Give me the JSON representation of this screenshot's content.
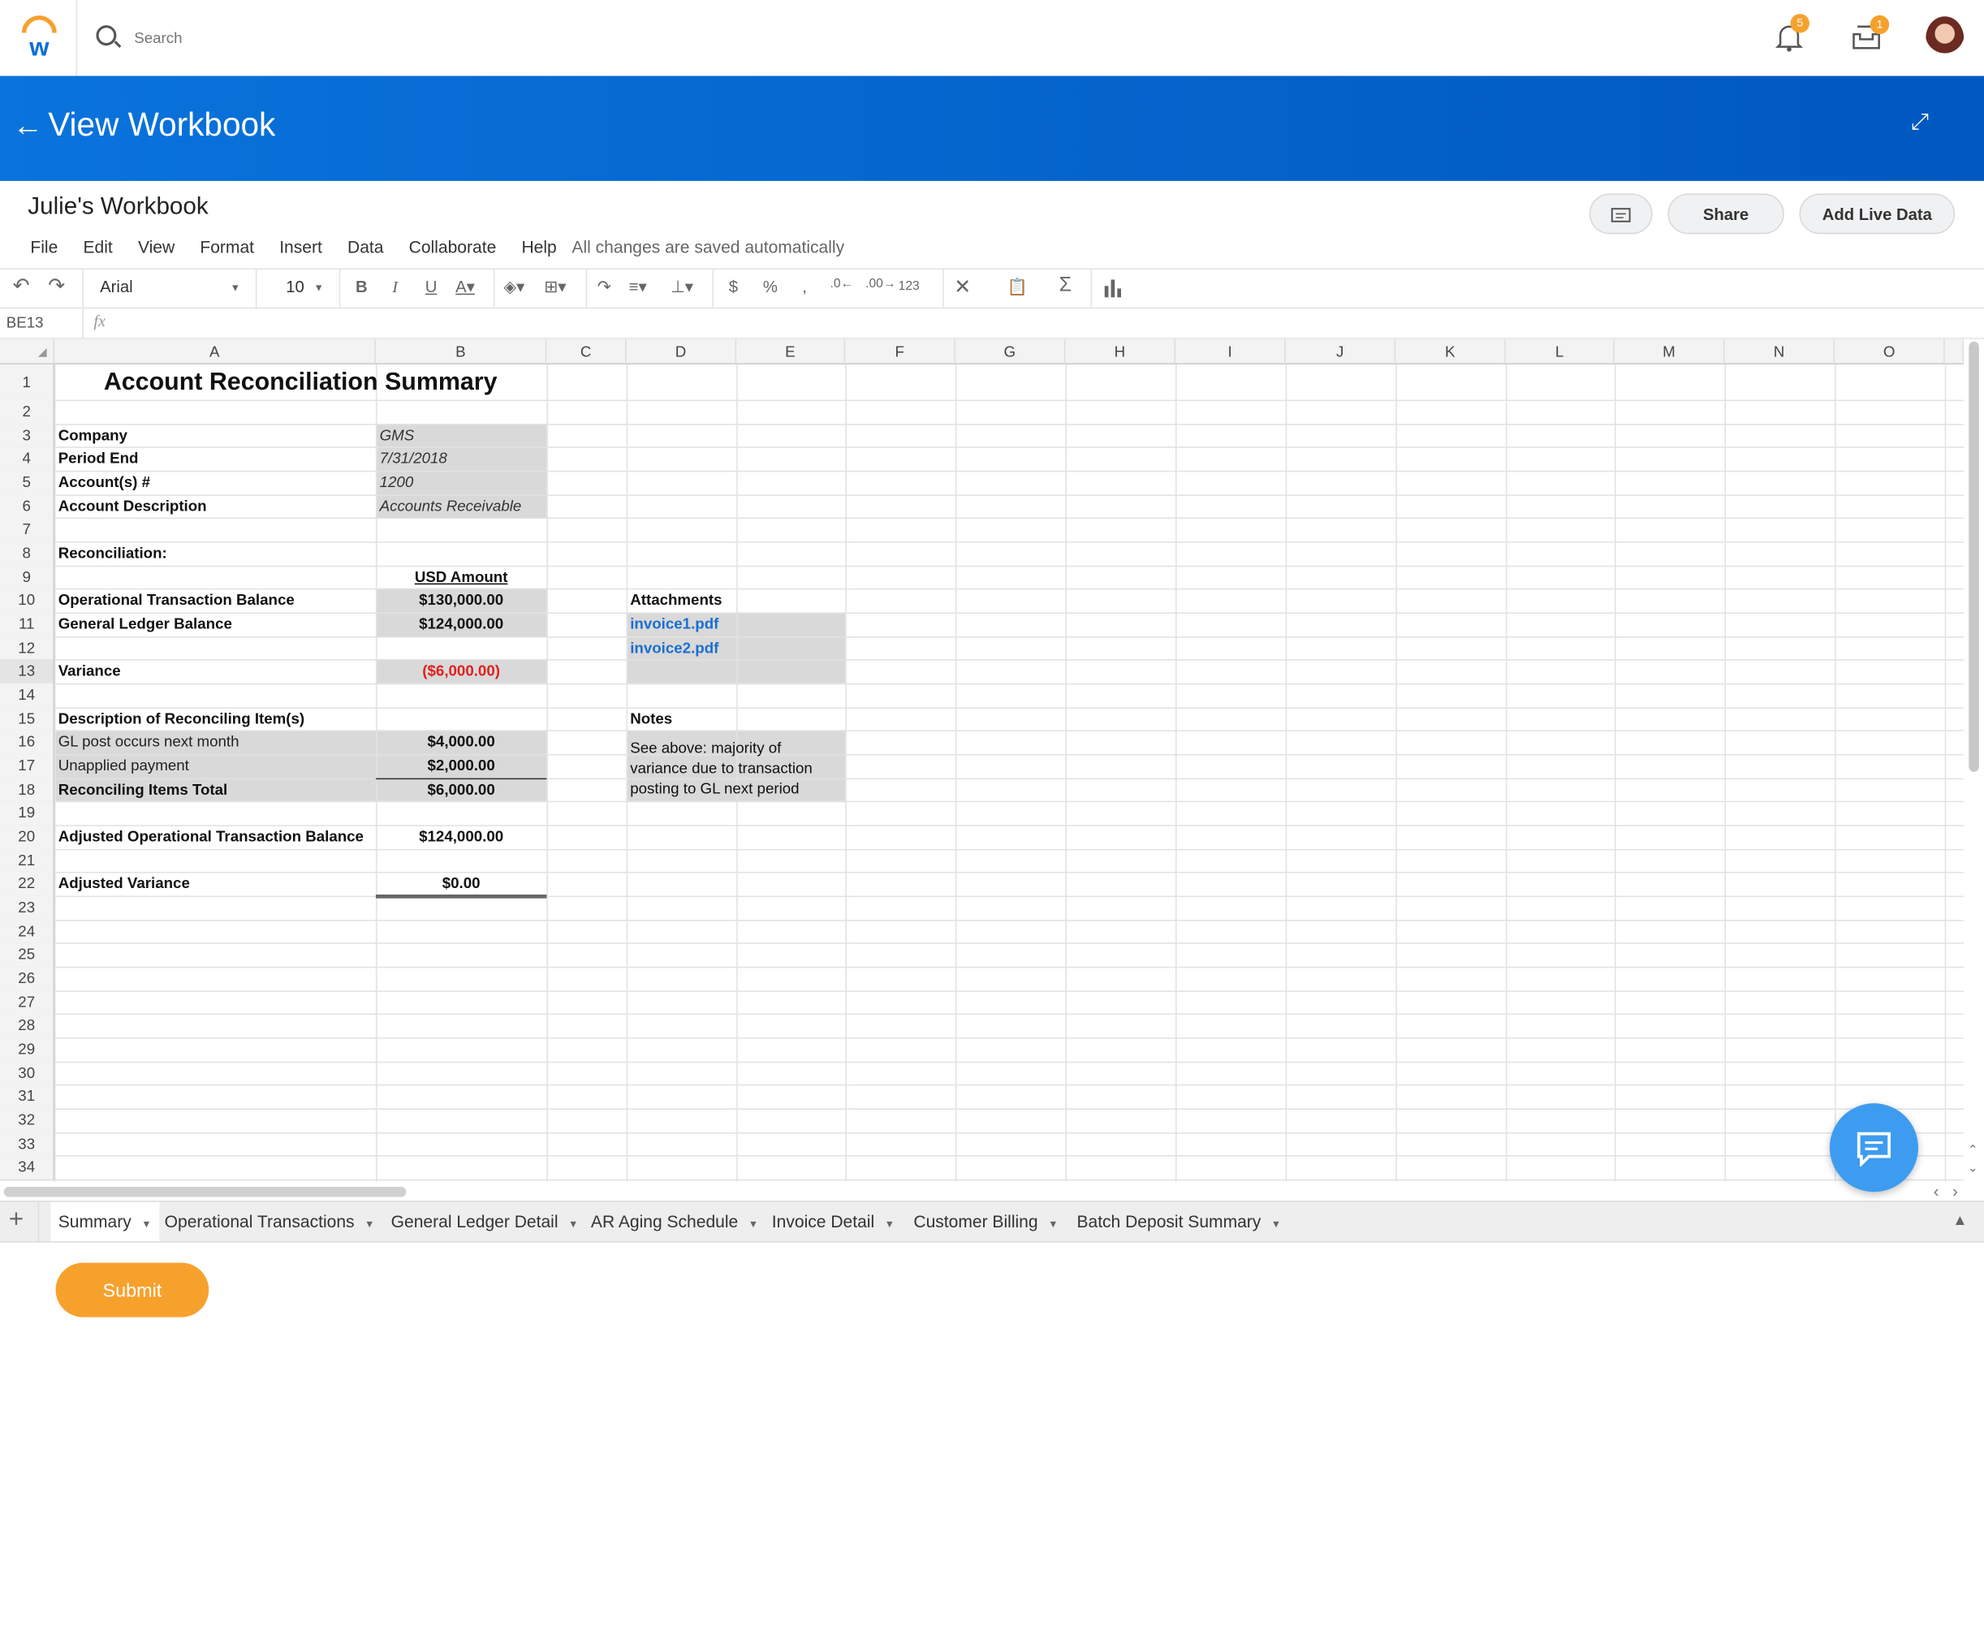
{
  "topbar": {
    "search_placeholder": "Search",
    "notifications_count": "5",
    "inbox_count": "1"
  },
  "header": {
    "title": "View Workbook"
  },
  "workbook": {
    "title": "Julie's Workbook",
    "share_label": "Share",
    "add_live_data_label": "Add Live Data",
    "menu": [
      "File",
      "Edit",
      "View",
      "Format",
      "Insert",
      "Data",
      "Collaborate",
      "Help"
    ],
    "save_status": "All changes are saved automatically"
  },
  "toolbar": {
    "font": "Arial",
    "font_size": "10",
    "number_format": "123"
  },
  "formula_bar": {
    "cell_ref": "BE13",
    "fx": "fx",
    "value": ""
  },
  "sheet": {
    "columns": [
      "A",
      "B",
      "C",
      "D",
      "E",
      "F",
      "G",
      "H",
      "I",
      "J",
      "K",
      "L",
      "M",
      "N",
      "O"
    ],
    "row_count": 34,
    "selected_row": 13,
    "cells": {
      "A1": "Account Reconciliation Summary",
      "A3": "Company",
      "B3": "GMS",
      "A4": "Period End",
      "B4": "7/31/2018",
      "A5": "Account(s) #",
      "B5": "1200",
      "A6": "Account Description",
      "B6": "Accounts Receivable",
      "A8": "Reconciliation:",
      "B9": "USD Amount",
      "A10": "Operational Transaction Balance",
      "B10": "$130,000.00",
      "D10": "Attachments",
      "A11": "General Ledger Balance",
      "B11": "$124,000.00",
      "D11": "invoice1.pdf",
      "D12": "invoice2.pdf",
      "A13": "Variance",
      "B13": "($6,000.00)",
      "A15": "Description of Reconciling Item(s)",
      "D15": "Notes",
      "A16": "GL post occurs next month",
      "B16": "$4,000.00",
      "D16": "See above: majority of variance due to transaction posting to GL next period",
      "A17": "Unapplied payment",
      "B17": "$2,000.00",
      "A18": "Reconciling Items Total",
      "B18": "$6,000.00",
      "A20": "Adjusted Operational Transaction Balance",
      "B20": "$124,000.00",
      "A22": "Adjusted Variance",
      "B22": "$0.00"
    },
    "colors": {
      "fill": "#d9d9d9",
      "negative": "#e02020",
      "link": "#1a6ecf"
    }
  },
  "sheet_tabs": [
    {
      "label": "Summary",
      "active": true
    },
    {
      "label": "Operational Transactions"
    },
    {
      "label": "General Ledger Detail"
    },
    {
      "label": "AR Aging Schedule"
    },
    {
      "label": "Invoice Detail"
    },
    {
      "label": "Customer Billing"
    },
    {
      "label": "Batch Deposit Summary"
    }
  ],
  "submit_label": "Submit",
  "colors": {
    "header_blue": "#0a73dc",
    "accent_orange": "#f7a12d",
    "fab_blue": "#3d9cf0"
  }
}
